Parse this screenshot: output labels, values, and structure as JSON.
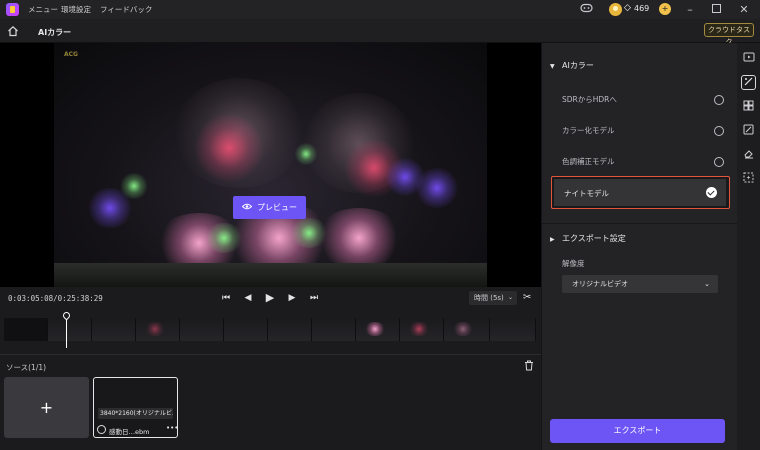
{
  "titlebar": {
    "menu": [
      "メニュー",
      "環境設定",
      "フィードバック"
    ],
    "credits": "469",
    "icons": [
      "app-logo",
      "gamepad-icon",
      "avatar",
      "gem-icon",
      "plus-icon",
      "minimize-icon",
      "maximize-icon",
      "close-icon"
    ]
  },
  "header": {
    "title": "AIカラー",
    "cloud_task": "クラウドタスク"
  },
  "preview": {
    "watermark": "ACG",
    "button_label": "プレビュー"
  },
  "controls": {
    "timecode": "0:03:05:08/0:25:38:29",
    "duration_label": "時間 (5s)"
  },
  "source": {
    "title": "ソース(1/1)",
    "media": {
      "resolution": "3840*2160(オリジナルビ…",
      "name": "感動日…ebm",
      "more": "•••"
    }
  },
  "panel": {
    "section_title": "AIカラー",
    "options": [
      {
        "label": "SDRからHDRへ",
        "selected": false
      },
      {
        "label": "カラー化モデル",
        "selected": false
      },
      {
        "label": "色調補正モデル",
        "selected": false
      },
      {
        "label": "ナイトモデル",
        "selected": true
      }
    ],
    "export_settings_title": "エクスポート設定",
    "resolution_label": "解像度",
    "resolution_value": "オリジナルビデオ",
    "export_button": "エクスポート"
  },
  "colors": {
    "accent": "#6d54f5",
    "highlight_border": "#e2553a",
    "panel_bg": "#232326"
  }
}
